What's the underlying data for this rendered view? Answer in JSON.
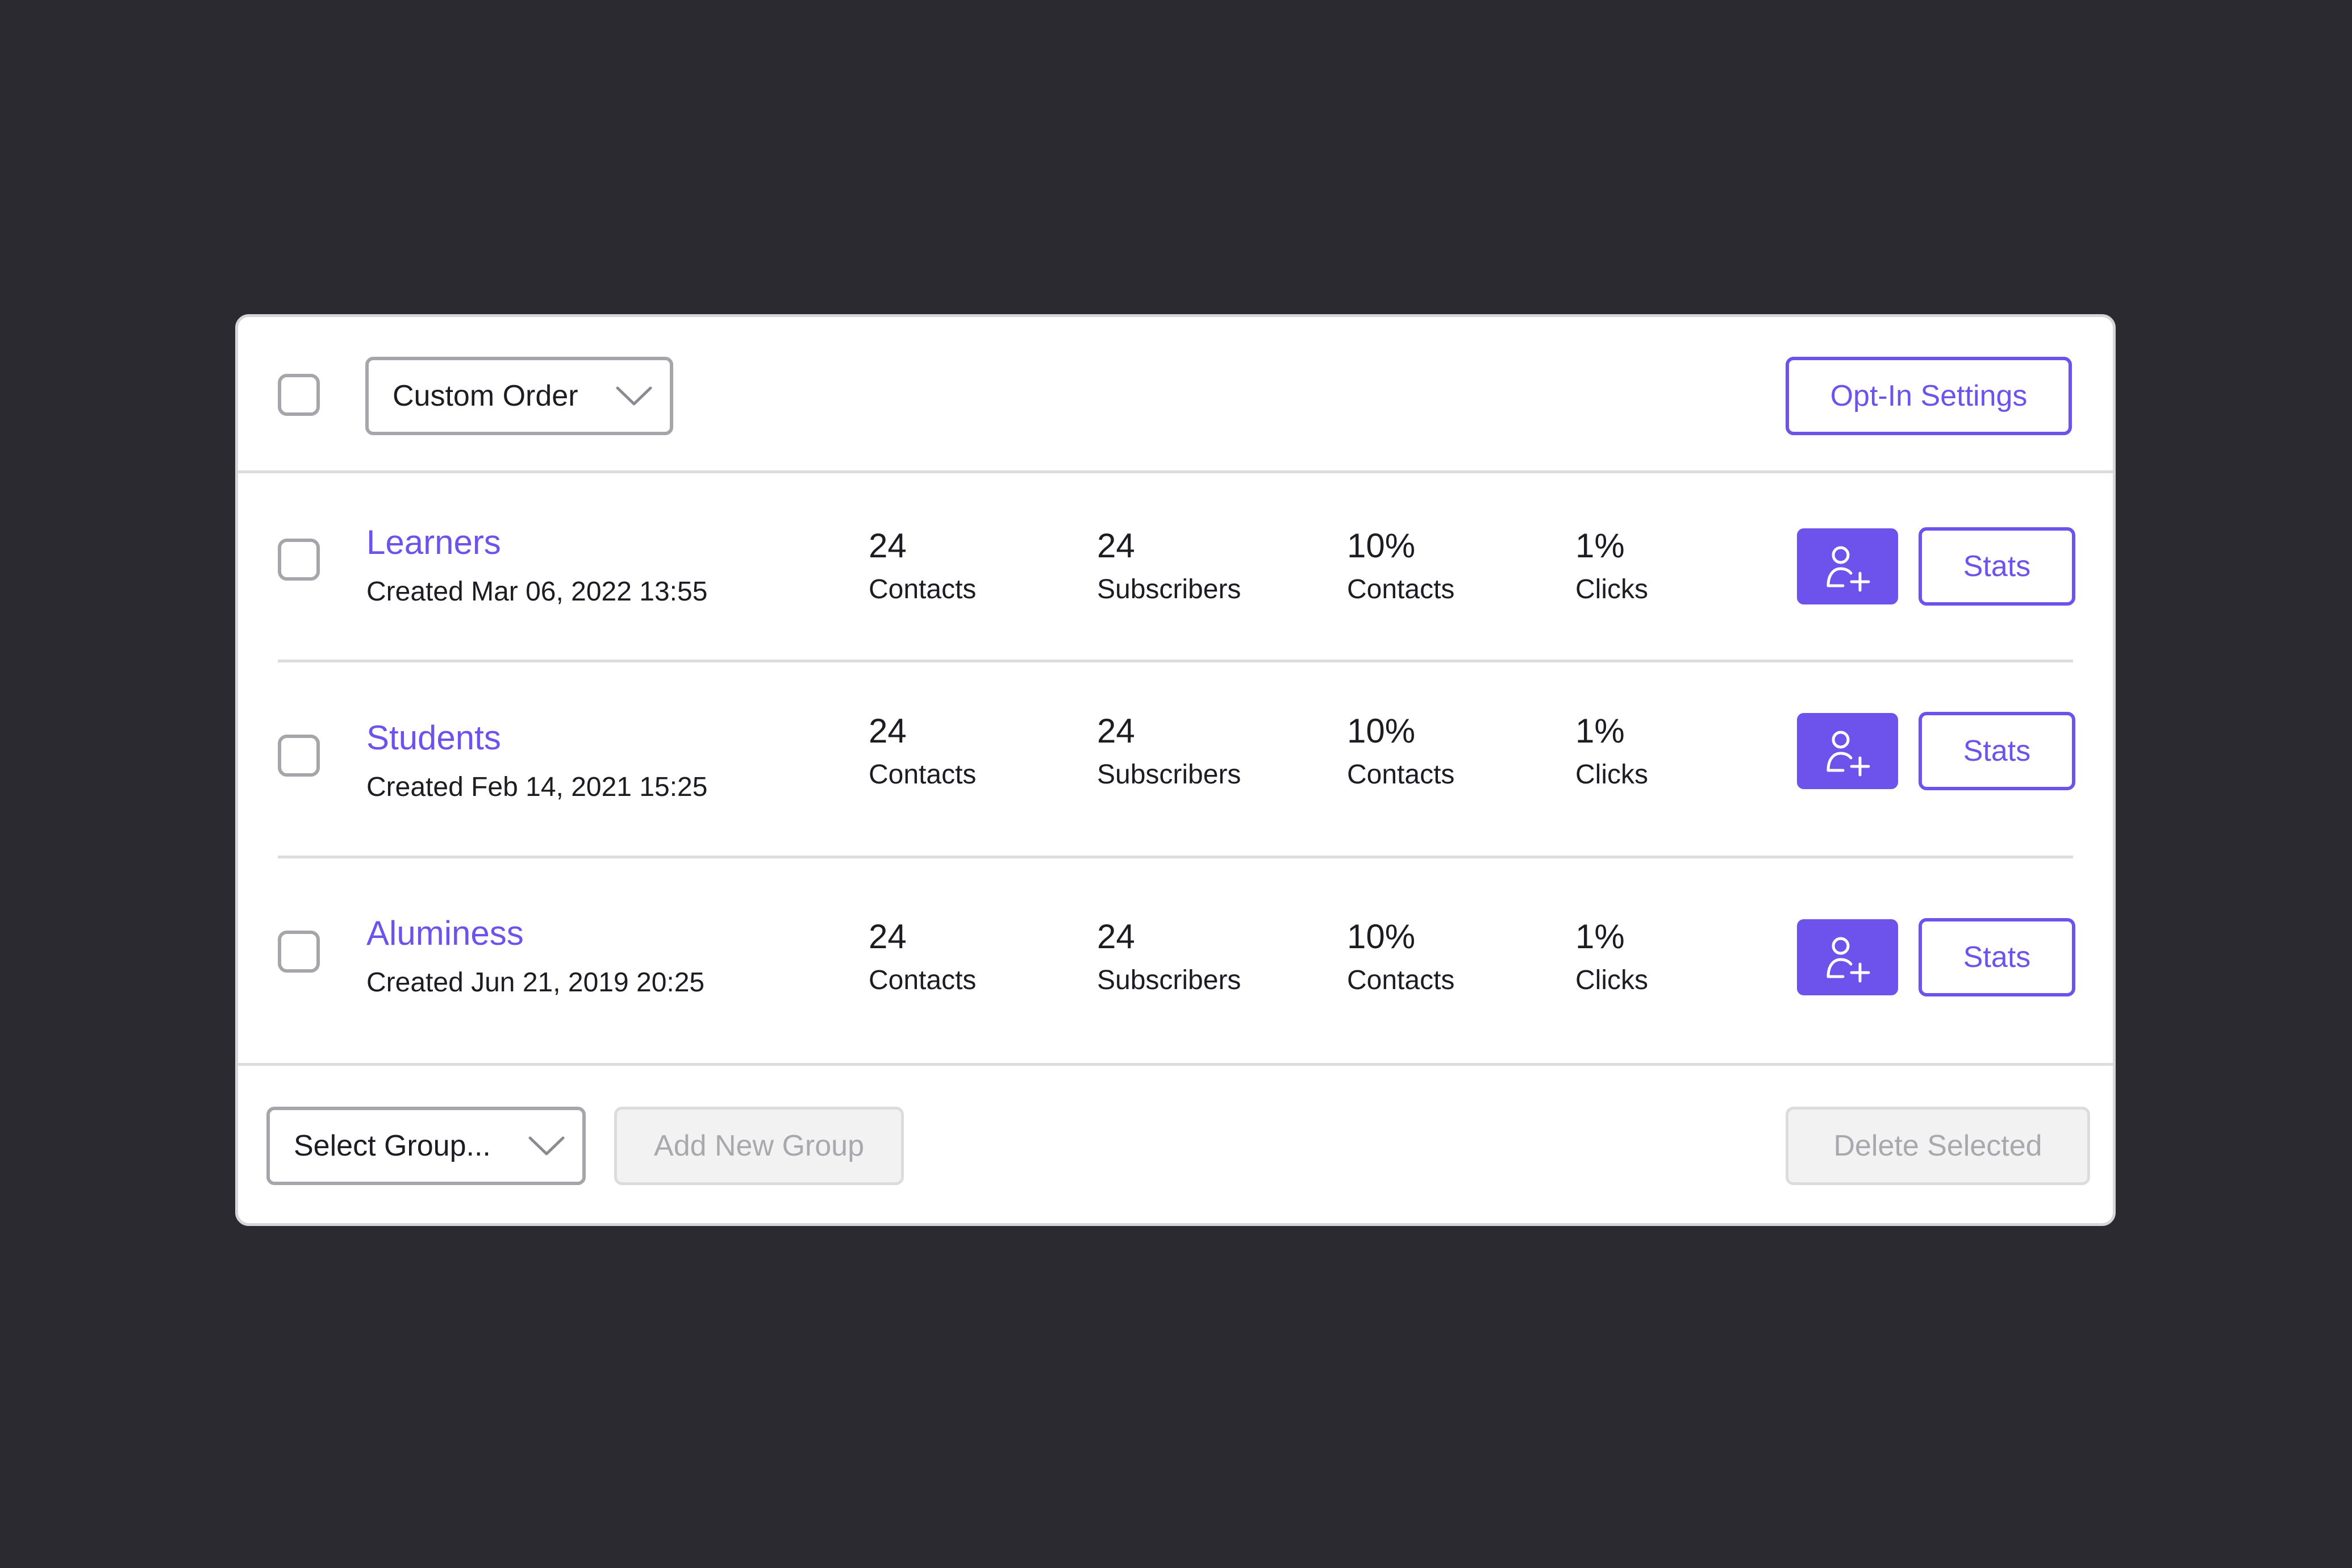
{
  "toolbar": {
    "sort_dropdown": "Custom Order",
    "opt_in_button": "Opt-In Settings"
  },
  "groups": [
    {
      "name": "Learners",
      "created": "Created Mar 06, 2022 13:55",
      "stats": [
        {
          "value": "24",
          "label": "Contacts"
        },
        {
          "value": "24",
          "label": "Subscribers"
        },
        {
          "value": "10%",
          "label": "Contacts"
        },
        {
          "value": "1%",
          "label": "Clicks"
        }
      ],
      "stats_button": "Stats"
    },
    {
      "name": "Students",
      "created": "Created Feb 14, 2021 15:25",
      "stats": [
        {
          "value": "24",
          "label": "Contacts"
        },
        {
          "value": "24",
          "label": "Subscribers"
        },
        {
          "value": "10%",
          "label": "Contacts"
        },
        {
          "value": "1%",
          "label": "Clicks"
        }
      ],
      "stats_button": "Stats"
    },
    {
      "name": "Aluminess",
      "created": "Created Jun 21, 2019 20:25",
      "stats": [
        {
          "value": "24",
          "label": "Contacts"
        },
        {
          "value": "24",
          "label": "Subscribers"
        },
        {
          "value": "10%",
          "label": "Contacts"
        },
        {
          "value": "1%",
          "label": "Clicks"
        }
      ],
      "stats_button": "Stats"
    }
  ],
  "footer": {
    "group_select": "Select Group...",
    "add_group_button": "Add New Group",
    "delete_button": "Delete Selected"
  },
  "icons": {
    "add_contact": "user-plus-icon",
    "dropdown": "chevron-down-icon"
  },
  "colors": {
    "accent": "#6e52ec",
    "background": "#2b2a30",
    "card": "#ffffff",
    "disabled_bg": "#f2f2f3",
    "disabled_text": "#a8a8ad"
  }
}
